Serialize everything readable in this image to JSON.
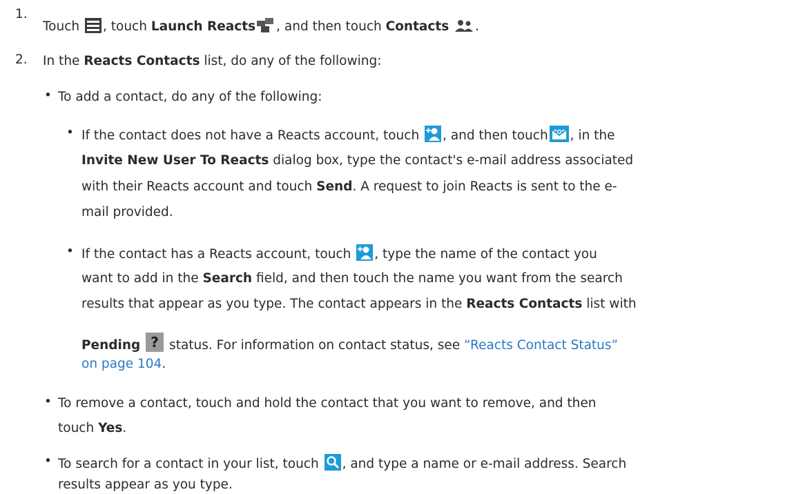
{
  "step1": {
    "number": "1.",
    "t1": "Touch ",
    "t2": ", touch ",
    "b1": "Launch Reacts",
    "t3": ", and then touch ",
    "b2": "Contacts",
    "t4": "."
  },
  "step2": {
    "number": "2.",
    "t1": "In the ",
    "b1": "Reacts Contacts",
    "t2": " list, do any of the following:"
  },
  "add": {
    "bullet": "•",
    "text": "To add a contact, do any of the following:"
  },
  "invite": {
    "bullet": "•",
    "l1a": "If the contact does not have a Reacts account, touch ",
    "l1b": ", and then touch",
    "l1c": ", in the",
    "l2b": "Invite New User To Reacts",
    "l2t": " dialog box, type the contact's e-mail address associated",
    "l3a": "with their Reacts account and touch ",
    "l3b": "Send",
    "l3c": ". A request to join Reacts is sent to the e-",
    "l4": "mail provided."
  },
  "existing": {
    "bullet": "•",
    "l1a": "If the contact has a Reacts account, touch ",
    "l1b": ", type the name of the contact you",
    "l2a": "want to add in the ",
    "l2b": "Search",
    "l2c": " field, and then touch the name you want from the search",
    "l3a": "results that appear as you type. The contact appears in the ",
    "l3b": "Reacts Contacts",
    "l3c": " list with",
    "l4b": "Pending",
    "l4c": " status. For information on contact status, see ",
    "l4link": "“Reacts Contact Status”",
    "l5link": "on page 104",
    "l5c": "."
  },
  "remove": {
    "bullet": "•",
    "l1": "To remove a contact, touch and hold the contact that you want to remove, and then",
    "l2a": "touch ",
    "l2b": "Yes",
    "l2c": "."
  },
  "search": {
    "bullet": "•",
    "l1a": "To search for a contact in your list, touch ",
    "l1b": ", and type a name or e-mail address. Search",
    "l2": "results appear as you type."
  },
  "colors": {
    "text": "#2b2b2b",
    "link": "#2a78c2",
    "icon_blue": "#1e9ad6",
    "icon_gray": "#3c3c3c"
  }
}
